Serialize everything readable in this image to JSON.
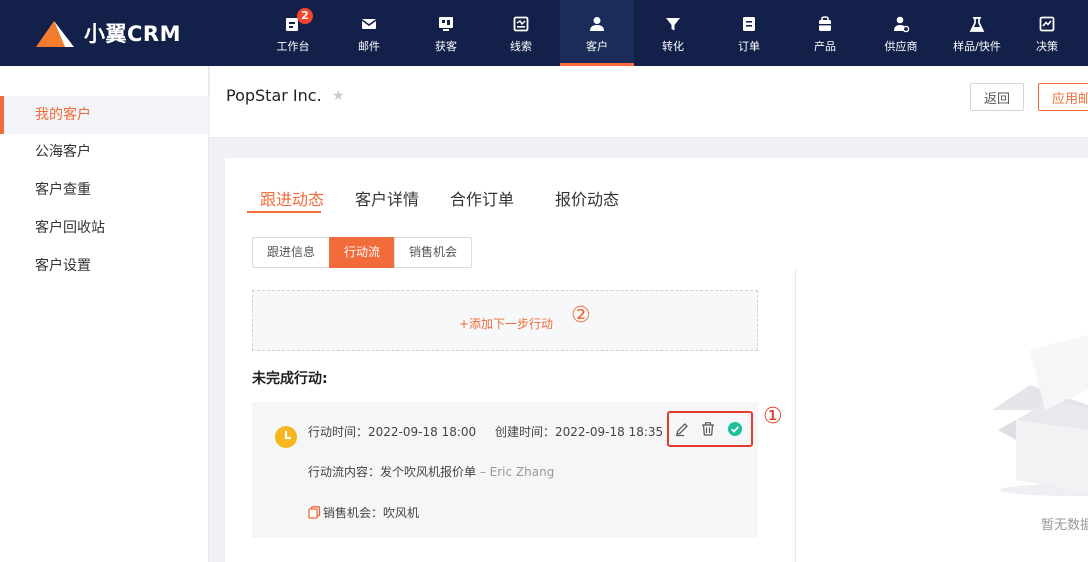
{
  "app": {
    "name": "小翼CRM"
  },
  "nav": [
    {
      "label": "工作台",
      "icon": "dashboard-icon",
      "badge": "2"
    },
    {
      "label": "邮件",
      "icon": "mail-icon"
    },
    {
      "label": "获客",
      "icon": "acquire-icon"
    },
    {
      "label": "线索",
      "icon": "leads-icon"
    },
    {
      "label": "客户",
      "icon": "customer-icon",
      "active": true
    },
    {
      "label": "转化",
      "icon": "funnel-icon"
    },
    {
      "label": "订单",
      "icon": "order-icon"
    },
    {
      "label": "产品",
      "icon": "product-icon"
    },
    {
      "label": "供应商",
      "icon": "supplier-icon"
    },
    {
      "label": "样品/快件",
      "icon": "flask-icon"
    },
    {
      "label": "决策",
      "icon": "chart-icon"
    }
  ],
  "sidebar": {
    "items": [
      {
        "label": "我的客户",
        "active": true
      },
      {
        "label": "公海客户"
      },
      {
        "label": "客户查重"
      },
      {
        "label": "客户回收站"
      },
      {
        "label": "客户设置"
      }
    ]
  },
  "header": {
    "company": "PopStar Inc.",
    "back_label": "返回",
    "apply_label": "应用邮"
  },
  "tabs": [
    {
      "label": "跟进动态",
      "active": true
    },
    {
      "label": "客户详情"
    },
    {
      "label": "合作订单"
    },
    {
      "label": "报价动态"
    }
  ],
  "subtabs": [
    {
      "label": "跟进信息"
    },
    {
      "label": "行动流",
      "active": true
    },
    {
      "label": "销售机会"
    }
  ],
  "add_action": {
    "label": "+添加下一步行动",
    "marker": "②"
  },
  "pending": {
    "title": "未完成行动:",
    "action_time": "行动时间：2022-09-18 18:00",
    "created_time": "创建时间：2022-09-18 18:35",
    "content_label": "行动流内容：发个吹风机报价单",
    "author": " – Eric Zhang",
    "opportunity": "销售机会：吹风机",
    "marker": "①"
  },
  "empty": {
    "text": "暂无数据"
  },
  "colors": {
    "nav_bg": "#13214a",
    "accent": "#f26b3a",
    "highlight": "#e53b2c",
    "complete": "#1fbf9a"
  }
}
